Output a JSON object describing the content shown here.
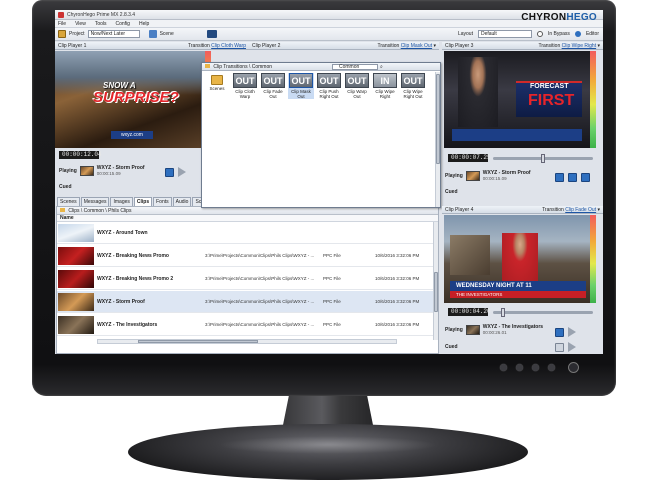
{
  "app": {
    "title": "ChyronHego Prime MX 2.8.3.4",
    "brand_left": "CHYRON",
    "brand_right": "HEGO"
  },
  "menu": [
    "File",
    "View",
    "Tools",
    "Config",
    "Help"
  ],
  "toolbar": {
    "project_label": "Project",
    "project_value": "Now/Next Later",
    "scene_label": "Scene",
    "layout_label": "Layout",
    "layout_value": "Default",
    "bypass_label": "In Bypass",
    "editor_label": "Editor"
  },
  "player1": {
    "title": "Clip Player 1",
    "transition_label": "Transition",
    "transition_value": "Clip Cloth Warp",
    "video_text_small": "SNOW A",
    "video_text_big": "SURPRISE?",
    "video_logo": "wxyz.com",
    "timecode": "00:00:12.04",
    "playing_label": "Playing",
    "clip_name": "WXYZ - Storm Proof",
    "clip_time": "00:00:15.09",
    "cued_label": "Cued"
  },
  "player2": {
    "title": "Clip Player 2",
    "transition_label": "Transition",
    "transition_value": "Clip Mask Out"
  },
  "player3": {
    "title": "Clip Player 3",
    "transition_label": "Transition",
    "transition_value": "Clip Wipe Right",
    "video_text_small": "FORECAST",
    "video_text_big": "FIRST",
    "timecode": "00:00:07.25",
    "playing_label": "Playing",
    "clip_name": "WXYZ - Storm Proof",
    "clip_time": "00:00:15.09",
    "cued_label": "Cued"
  },
  "player4": {
    "title": "Clip Player 4",
    "transition_label": "Transition",
    "transition_value": "Clip Fade Out",
    "lower_third": "WEDNESDAY NIGHT AT 11",
    "lower_third_sub": "THE INVESTIGATORS",
    "timecode": "00:00:04.20",
    "playing_label": "Playing",
    "clip_name": "WXYZ - The Investigators",
    "clip_time": "00:00:26.01",
    "cued_label": "Cued"
  },
  "picker": {
    "breadcrumb": "Clip Transitions  \\  Common",
    "search_value": "Common",
    "items": [
      {
        "tile": "",
        "label": "Scenes"
      },
      {
        "tile": "OUT",
        "label": "Clip Cloth Warp"
      },
      {
        "tile": "OUT",
        "label": "Clip Fade Out"
      },
      {
        "tile": "OUT",
        "label": "Clip Mask Out"
      },
      {
        "tile": "OUT",
        "label": "Clip Push Right Out"
      },
      {
        "tile": "OUT",
        "label": "Clip Warp Out"
      },
      {
        "tile": "IN",
        "label": "Clip Wipe Right"
      },
      {
        "tile": "OUT",
        "label": "Clip Wipe Right Out"
      }
    ]
  },
  "tabs": [
    "Scenes",
    "Messages",
    "Images",
    "Clips",
    "Fonts",
    "Audio",
    "Scripts"
  ],
  "clips_browser": {
    "breadcrumb": "Clips  \\  Common  \\  Phils Clips",
    "column_name": "Name",
    "rows": [
      {
        "name": "WXYZ - Around Town",
        "path": "",
        "type": "",
        "date": ""
      },
      {
        "name": "WXYZ - Breaking News Promo",
        "path": "3:\\Prime\\Projects\\Common\\Clips\\Phils Clips\\WXYZ - ...",
        "type": "PPC File",
        "date": "10/6/2016 3:32:06 PM"
      },
      {
        "name": "WXYZ - Breaking News Promo 2",
        "path": "3:\\Prime\\Projects\\Common\\Clips\\Phils Clips\\WXYZ - ...",
        "type": "PPC File",
        "date": "10/6/2016 3:32:06 PM"
      },
      {
        "name": "WXYZ - Storm Proof",
        "path": "3:\\Prime\\Projects\\Common\\Clips\\Phils Clips\\WXYZ - ...",
        "type": "PPC File",
        "date": "10/6/2016 3:32:06 PM"
      },
      {
        "name": "WXYZ - The Investigators",
        "path": "3:\\Prime\\Projects\\Common\\Clips\\Phils Clips\\WXYZ - ...",
        "type": "PPC File",
        "date": "10/6/2016 3:32:06 PM"
      }
    ]
  }
}
